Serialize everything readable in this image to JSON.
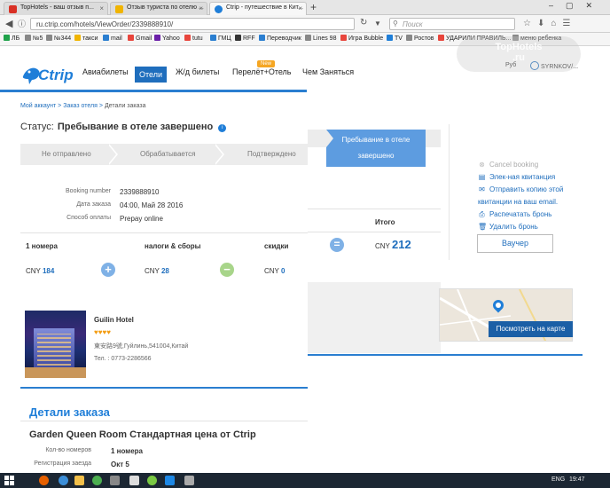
{
  "browser": {
    "tabs": [
      {
        "title": "TopHotels - ваш отзыв п...",
        "active": false
      },
      {
        "title": "Отзыв туриста по отелю ...",
        "active": false
      },
      {
        "title": "Ctrip - путешествие в Кит...",
        "active": true
      }
    ],
    "new_tab": "+",
    "url": "ru.ctrip.com/hotels/ViewOrder/2339888910/",
    "search_placeholder": "Поиск",
    "bookmarks": [
      "ЛБ",
      "№5",
      "№344",
      "такси",
      "mail",
      "Gmail",
      "Yahoo",
      "tutu",
      "ГМЦ",
      "RFF",
      "Переводчик",
      "Lines 98",
      "Игра Bubble",
      "TV",
      "Ростов",
      "УДАРИЛИ ПРАВИЛЬ...",
      "меню ребенка"
    ]
  },
  "header": {
    "logo": "Ctrip",
    "nav": [
      "Авиабилеты",
      "Отели",
      "Ж/д билеты",
      "Перелёт+Отель",
      "Ч",
      "ем Заняться"
    ],
    "new_badge": "New",
    "lang": "Руб",
    "user": "SYRNKOV/..."
  },
  "breadcrumb": {
    "items": [
      "Мой аккаунт",
      "Заказ отеля",
      "Детали заказа"
    ],
    "separator": ">"
  },
  "status": {
    "label": "Статус:",
    "value": "Пребывание в отеле завершено",
    "info_icon": "i"
  },
  "steps": [
    "Не отправлено",
    "Обрабатывается",
    "Подтверждено",
    "Пребывание в отеле завершено"
  ],
  "details": [
    {
      "label": "Booking number",
      "value": "2339888910"
    },
    {
      "label": "Дата заказа",
      "value": "04:00, Май 28 2016"
    },
    {
      "label": "Способ оплаты",
      "value": "Prepay online"
    }
  ],
  "price": {
    "rooms_label": "1 номера",
    "rooms_currency": "CNY",
    "rooms_value": "184",
    "plus": "+",
    "taxes_label": "налоги & сборы",
    "taxes_currency": "CNY",
    "taxes_value": "28",
    "minus": "−",
    "discount_label": "скидки",
    "discount_currency": "CNY",
    "discount_value": "0",
    "equals": "=",
    "total_label": "Итого",
    "total_currency": "CNY",
    "total_value": "212"
  },
  "actions": {
    "cancel": "Cancel booking",
    "receipt": "Элек-ная квитанция",
    "send_copy_1": "Отправить копию этой",
    "send_copy_2": "квитанции на ваш email.",
    "print": "Распечатать бронь",
    "delete": "Удалить бронь",
    "voucher": "Ваучер"
  },
  "map": {
    "button": "Посмотреть на карте"
  },
  "hotel": {
    "name": "Guilin Hotel",
    "hearts": "♥♥♥♥",
    "address": "東安路9號,Гуйлинь,541004,Китай",
    "phone": "Тел. : 0773-2286566"
  },
  "order": {
    "title": "Детали заказа",
    "room": "Garden Queen Room Стандартная цена от Ctrip",
    "rows": [
      {
        "label": "Кол-во номеров",
        "value": "1 номера"
      },
      {
        "label": "Регистрация заезда",
        "value": "Окт 5"
      }
    ]
  },
  "taskbar": {
    "lang": "ENG",
    "time": "19:47"
  },
  "colors": {
    "brand": "#1f7ed8",
    "nav_active": "#1f6ebd",
    "step_active": "#5d9ce0",
    "plus": "#7fb1e6",
    "minus": "#a8d58a"
  }
}
